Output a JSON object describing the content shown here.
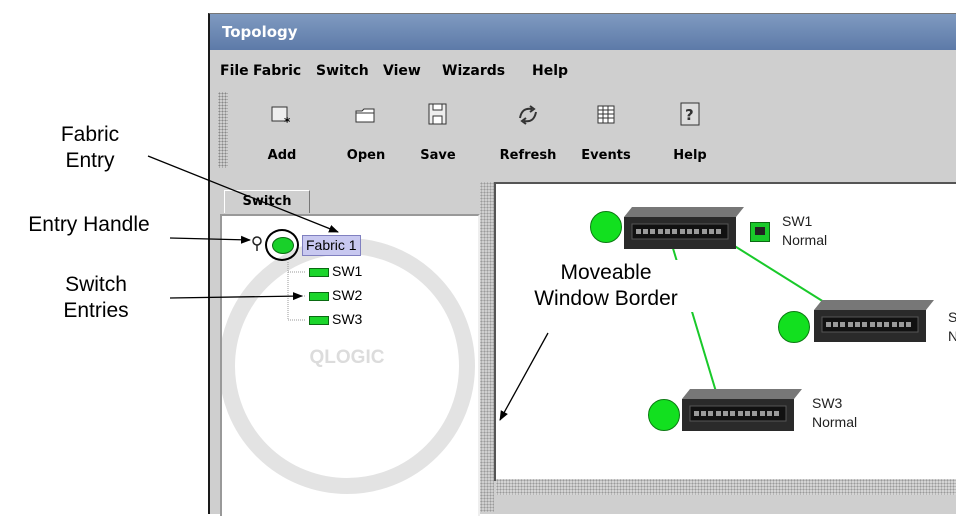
{
  "window": {
    "title": "Topology"
  },
  "menu": [
    "File",
    "Fabric",
    "Switch",
    "View",
    "Wizards",
    "Help"
  ],
  "toolbar": [
    "Add",
    "Open",
    "Save",
    "Refresh",
    "Events",
    "Help"
  ],
  "left_tab": "Switch",
  "tree": {
    "fabric": "Fabric 1",
    "switches": [
      "SW1",
      "SW2",
      "SW3"
    ]
  },
  "watermark": "QLOGIC",
  "topology": {
    "sw1": {
      "name": "SW1",
      "status": "Normal"
    },
    "sw2": {
      "name": "S",
      "status": "N"
    },
    "sw3": {
      "name": "SW3",
      "status": "Normal"
    }
  },
  "annotations": {
    "fabric_entry": [
      "Fabric",
      "Entry"
    ],
    "entry_handle": "Entry Handle",
    "switch_entries": [
      "Switch",
      "Entries"
    ],
    "moveable_border": [
      "Moveable",
      "Window Border"
    ]
  },
  "colors": {
    "status_green": "#12e01f",
    "title_bar": "#6b86b3",
    "tree_selection": "#c8c8f0"
  }
}
